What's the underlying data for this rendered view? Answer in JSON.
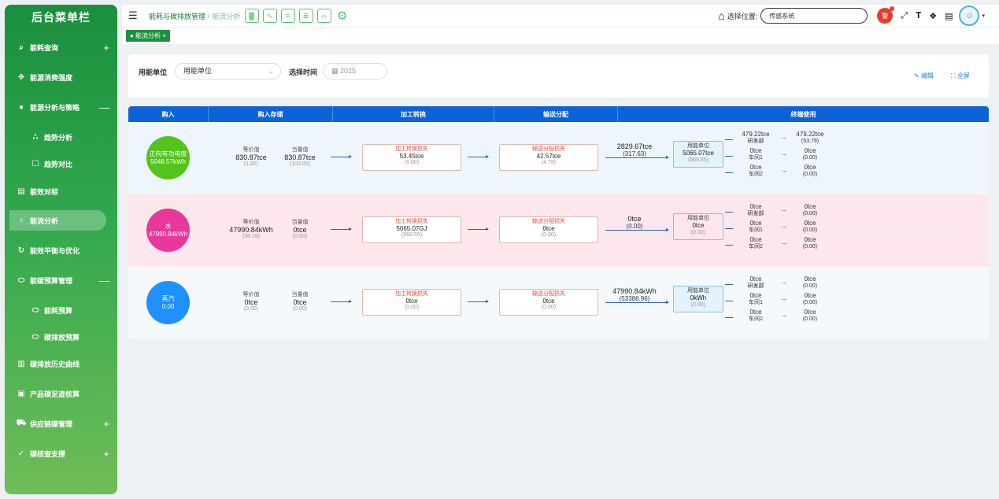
{
  "sidebar": {
    "title": "后台菜单栏",
    "items": [
      {
        "label": "能耗查询",
        "toggle": "+"
      },
      {
        "label": "能源消费强度"
      },
      {
        "label": "能源分析与策略",
        "toggle": "—"
      },
      {
        "label": "趋势分析"
      },
      {
        "label": "趋势对比"
      },
      {
        "label": "能效对标"
      },
      {
        "label": "能流分析"
      },
      {
        "label": "能效平衡与优化"
      },
      {
        "label": "能碳预算管理",
        "toggle": "—"
      },
      {
        "label": "能耗预算"
      },
      {
        "label": "碳排放预算"
      },
      {
        "label": "碳排放历史曲线"
      },
      {
        "label": "产品碳足迹核算"
      },
      {
        "label": "供应链碳管理",
        "toggle": "+"
      },
      {
        "label": "碳核查支撑",
        "toggle": "+"
      }
    ]
  },
  "header": {
    "breadcrumb_root": "能耗与碳排放管理",
    "breadcrumb_sep": "/",
    "breadcrumb_current": "能流分析",
    "location_label": "选择位置:",
    "location_value": "传感系统",
    "alarm_text": "警"
  },
  "tabs": [
    {
      "label": "● 能流分析 ×"
    }
  ],
  "filter": {
    "unit_label": "用能单位",
    "unit_value": "用能单位",
    "time_label": "选择时间",
    "time_value": "2025",
    "edit_label": "编辑",
    "fullscreen_label": "全屏"
  },
  "flow": {
    "headers": [
      "购入",
      "购入存储",
      "加工转换",
      "输送分配",
      "终端使用"
    ],
    "rows": [
      {
        "source": {
          "name": "正向有功电度",
          "value": "5048.57kWh",
          "color": "#52c41a"
        },
        "equiv": {
          "label": "等价值",
          "value": "830.87tce",
          "pct": "(1.82)"
        },
        "curr": {
          "label": "当量值",
          "value": "830.87tce",
          "pct": "(100.00)"
        },
        "process": {
          "label": "加工转换损失",
          "value": "53.45tce",
          "pct": "(6.00)"
        },
        "transmit": {
          "label": "输送分配损失",
          "value": "42.57tce",
          "pct": "(4.78)"
        },
        "transfer": {
          "value": "2829.67tce",
          "pct": "(317.63)"
        },
        "unit": {
          "name": "用能单位",
          "value": "5065.07tce",
          "pct": "(568.55)",
          "bg": "#e3f2fb"
        },
        "ends": [
          {
            "value": "479.22tce",
            "name": "研发部",
            "out_value": "479.22tce",
            "out_pct": "(53.79)"
          },
          {
            "value": "0tce",
            "name": "车间1",
            "out_value": "0tce",
            "out_pct": "(0.00)"
          },
          {
            "value": "0tce",
            "name": "车间2",
            "out_value": "0tce",
            "out_pct": "(0.00)"
          }
        ],
        "bg": "#eef6fb"
      },
      {
        "source": {
          "name": "水",
          "value": "47990.84kWh",
          "color": "#e8389b"
        },
        "equiv": {
          "label": "等价值",
          "value": "47990.84kWh",
          "pct": "(98.18)"
        },
        "curr": {
          "label": "当量值",
          "value": "0tce",
          "pct": "(0.00)"
        },
        "process": {
          "label": "加工转换损失",
          "value": "5065.07GJ",
          "pct": "(568.55)"
        },
        "transmit": {
          "label": "输送分配损失",
          "value": "0tce",
          "pct": "(0.00)"
        },
        "transfer": {
          "value": "0tce",
          "pct": "(0.00)"
        },
        "unit": {
          "name": "用能单位",
          "value": "0tce",
          "pct": "(0.00)",
          "bg": "#fde6ee"
        },
        "ends": [
          {
            "value": "0tce",
            "name": "研发部",
            "out_value": "0tce",
            "out_pct": "(0.00)"
          },
          {
            "value": "0tce",
            "name": "车间1",
            "out_value": "0tce",
            "out_pct": "(0.00)"
          },
          {
            "value": "0tce",
            "name": "车间2",
            "out_value": "0tce",
            "out_pct": "(0.00)"
          }
        ],
        "bg": "#fce7ec"
      },
      {
        "source": {
          "name": "蒸汽",
          "value": "0.00",
          "color": "#1e90ff"
        },
        "equiv": {
          "label": "等价值",
          "value": "0tce",
          "pct": "(0.00)"
        },
        "curr": {
          "label": "当量值",
          "value": "0tce",
          "pct": "(0.00)"
        },
        "process": {
          "label": "加工转换损失",
          "value": "0tce",
          "pct": "(0.00)"
        },
        "transmit": {
          "label": "输送分配损失",
          "value": "0tce",
          "pct": "(0.00)"
        },
        "transfer": {
          "value": "47990.84kWh",
          "pct": "(53386.96)"
        },
        "unit": {
          "name": "用能单位",
          "value": "0kWh",
          "pct": "(0.00)",
          "bg": "#e3f2fb"
        },
        "ends": [
          {
            "value": "0tce",
            "name": "研发部",
            "out_value": "0tce",
            "out_pct": "(0.00)"
          },
          {
            "value": "0tce",
            "name": "车间1",
            "out_value": "0tce",
            "out_pct": "(0.00)"
          },
          {
            "value": "0tce",
            "name": "车间2",
            "out_value": "0tce",
            "out_pct": "(0.00)"
          }
        ],
        "bg": "#f5f9fc"
      }
    ]
  }
}
